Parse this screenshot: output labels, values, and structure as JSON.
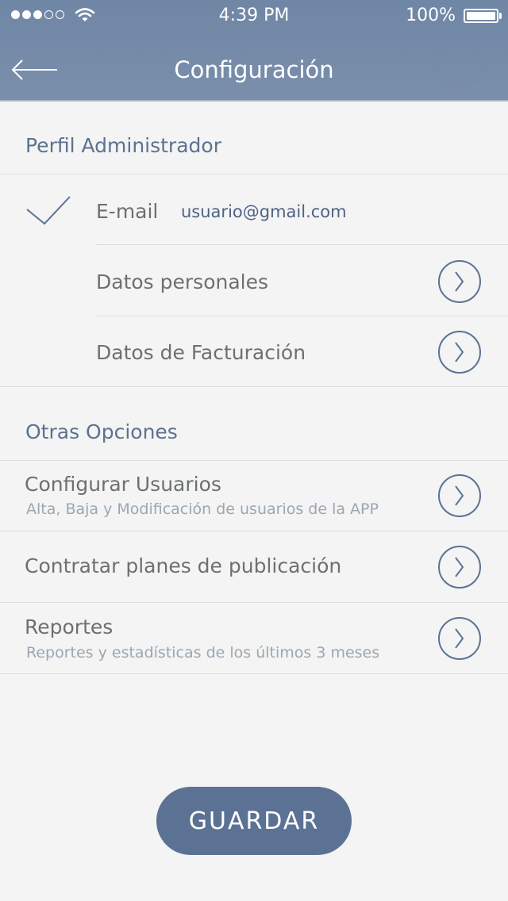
{
  "status_bar": {
    "time": "4:39 PM",
    "battery": "100%",
    "signal_dots_filled": 3,
    "signal_dots_total": 5
  },
  "nav": {
    "title": "Configuración",
    "back_icon": "arrow-left-icon"
  },
  "sections": {
    "admin_profile": {
      "title": "Perfil Administrador",
      "email_label": "E-mail",
      "email_value": "usuario@gmail.com",
      "personal_data": "Datos personales",
      "billing_data": "Datos de Facturación"
    },
    "other_options": {
      "title": "Otras Opciones",
      "configure_users": {
        "label": "Configurar Usuarios",
        "subtitle": "Alta, Baja y Modificación de usuarios de la APP"
      },
      "publication_plans": {
        "label": "Contratar planes de publicación"
      },
      "reports": {
        "label": "Reportes",
        "subtitle": "Reportes y estadísticas de los últimos 3 meses"
      }
    }
  },
  "actions": {
    "save_label": "GUARDAR"
  },
  "colors": {
    "header": "#7389a7",
    "accent": "#5c7294",
    "background": "#f3f4f3",
    "text": "#6d7073",
    "section_title": "#5d7191"
  }
}
